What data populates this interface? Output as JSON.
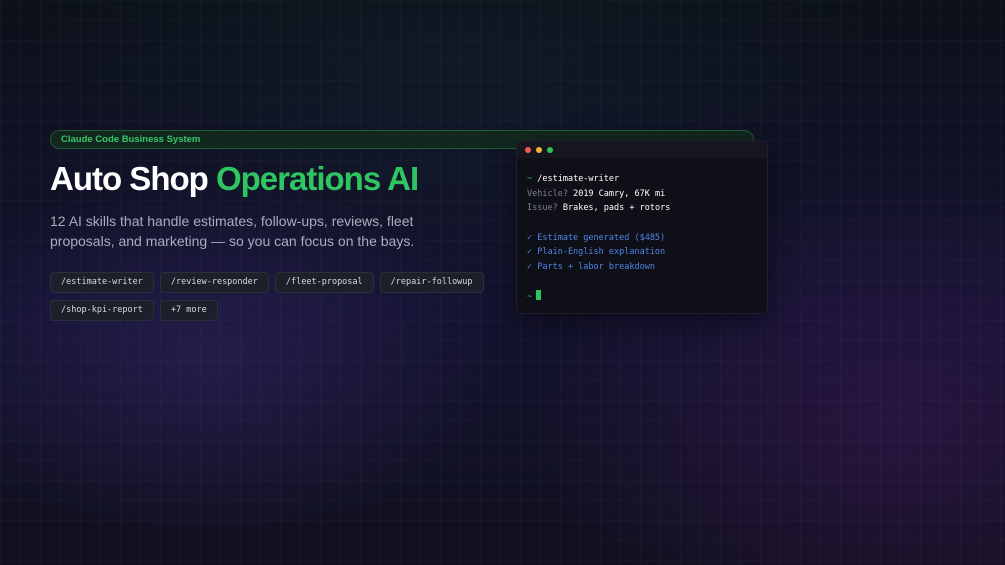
{
  "badge": {
    "label": "Claude Code Business System"
  },
  "hero": {
    "title_main": "Auto Shop",
    "title_accent": "Operations AI",
    "subtitle": "12 AI skills that handle estimates, follow-ups, reviews, fleet proposals, and marketing — so you can focus on the bays."
  },
  "skills": [
    {
      "label": "/estimate-writer"
    },
    {
      "label": "/review-responder"
    },
    {
      "label": "/fleet-proposal"
    },
    {
      "label": "/repair-followup"
    },
    {
      "label": "/shop-kpi-report"
    },
    {
      "label": "+7 more"
    }
  ],
  "terminal": {
    "prompt_symbol": "~",
    "command": "/estimate-writer",
    "vehicle_label": "Vehicle?",
    "vehicle_value": "2019 Camry, 67K mi",
    "issue_label": "Issue?",
    "issue_value": "Brakes, pads + rotors",
    "results": [
      "✓ Estimate generated ($485)",
      "✓ Plain-English explanation",
      "✓ Parts + labor breakdown"
    ]
  },
  "colors": {
    "accent_green": "#2fc561",
    "check_blue": "#4f86e8",
    "background": "#0f0f1b"
  }
}
